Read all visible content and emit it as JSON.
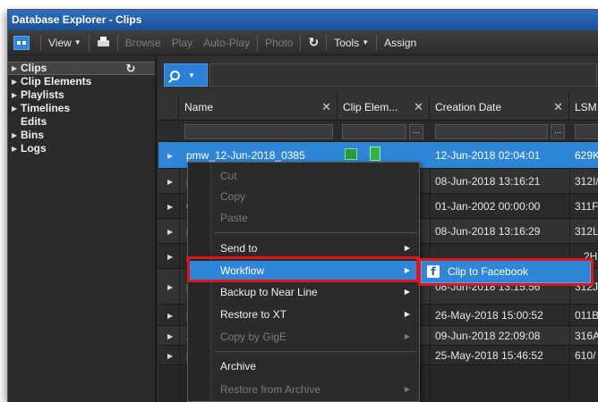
{
  "window": {
    "title": "Database Explorer - Clips"
  },
  "toolbar": {
    "view": "View",
    "browse": "Browse",
    "play": "Play",
    "autoplay": "Auto-Play",
    "photo": "Photo",
    "tools": "Tools",
    "assign": "Assign"
  },
  "sidebar": {
    "items": [
      {
        "label": "Clips"
      },
      {
        "label": "Clip Elements"
      },
      {
        "label": "Playlists"
      },
      {
        "label": "Timelines"
      },
      {
        "label": "Edits"
      },
      {
        "label": "Bins"
      },
      {
        "label": "Logs"
      }
    ]
  },
  "columns": [
    "Name",
    "Clip Elem...",
    "Creation Date",
    "LSM I"
  ],
  "filter_dots": "...",
  "rows": [
    {
      "name": "pmw_12-Jun-2018_0385",
      "date": "12-Jun-2018 02:04:01",
      "lsm": "629K"
    },
    {
      "name": "p",
      "date": "08-Jun-2018 13:16:21",
      "lsm": "312I/"
    },
    {
      "name": "0",
      "date": "01-Jan-2002 00:00:00",
      "lsm": "311F/"
    },
    {
      "name": "p",
      "date": "08-Jun-2018 13:16:29",
      "lsm": "312L/"
    },
    {
      "name": "p",
      "date": "",
      "lsm": "2H"
    },
    {
      "name": "p",
      "date": "08-Jun-2018 13:15:56",
      "lsm": "312J/"
    },
    {
      "name": "p",
      "date": "26-May-2018 15:00:52",
      "lsm": "011B/"
    },
    {
      "name": "2",
      "date": "09-Jun-2018 22:09:08",
      "lsm": "316A"
    },
    {
      "name": "p",
      "date": "25-May-2018 15:46:52",
      "lsm": "610/"
    }
  ],
  "context_menu": {
    "cut": "Cut",
    "copy": "Copy",
    "paste": "Paste",
    "send_to": "Send to",
    "workflow": "Workflow",
    "backup": "Backup to Near Line",
    "restore_xt": "Restore to XT",
    "copy_gige": "Copy by GigE",
    "archive": "Archive",
    "restore_archive": "Restore from Archive"
  },
  "submenu": {
    "facebook": "Clip to Facebook"
  },
  "colors": {
    "accent": "#2f86d8",
    "highlight": "#e0141b",
    "titlebar": "#1b4f98"
  }
}
